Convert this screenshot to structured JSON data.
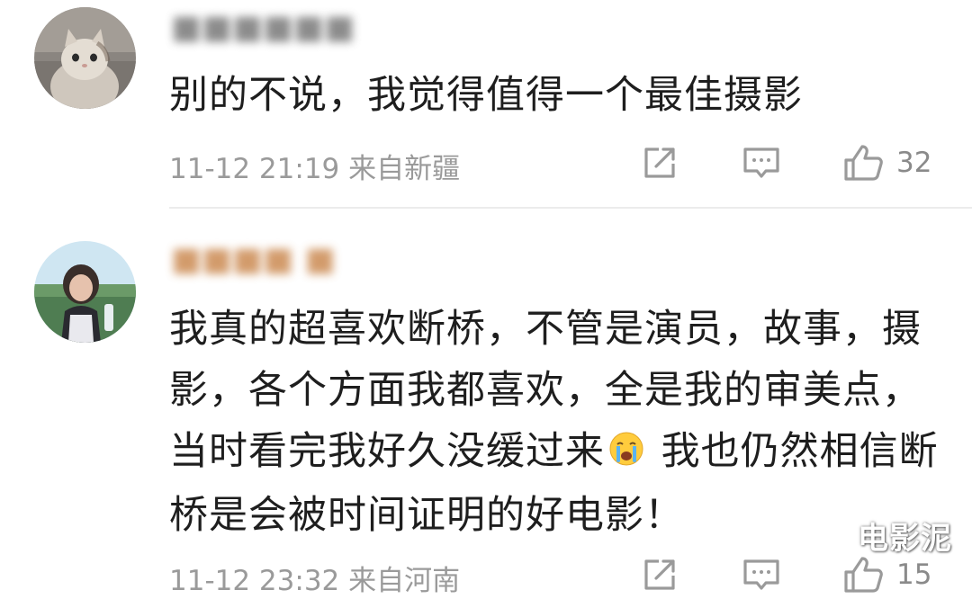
{
  "comments": [
    {
      "username": "■■■■■■",
      "text": "别的不说，我觉得值得一个最佳摄影",
      "timestamp": "11-12 21:19 来自新疆",
      "likes": "32"
    },
    {
      "username": "■■■■  ■",
      "text_part1": "我真的超喜欢断桥，不管是演员，故事，摄影，各个方面我都喜欢，全是我的审美点，当时看完我好久没缓过来",
      "emoji": "loudly-crying-face-icon",
      "text_part2": " 我也仍然相信断桥是会被时间证明的好电影！",
      "timestamp": "11-12 23:32 来自河南",
      "likes": "15"
    }
  ],
  "watermark": "电影泥",
  "icons": {
    "share": "share-icon",
    "reply": "comment-icon",
    "like": "thumbs-up-icon"
  },
  "colors": {
    "icon": "#9a9a9a",
    "meta_text": "#9a9a9a",
    "divider": "#ececec"
  }
}
